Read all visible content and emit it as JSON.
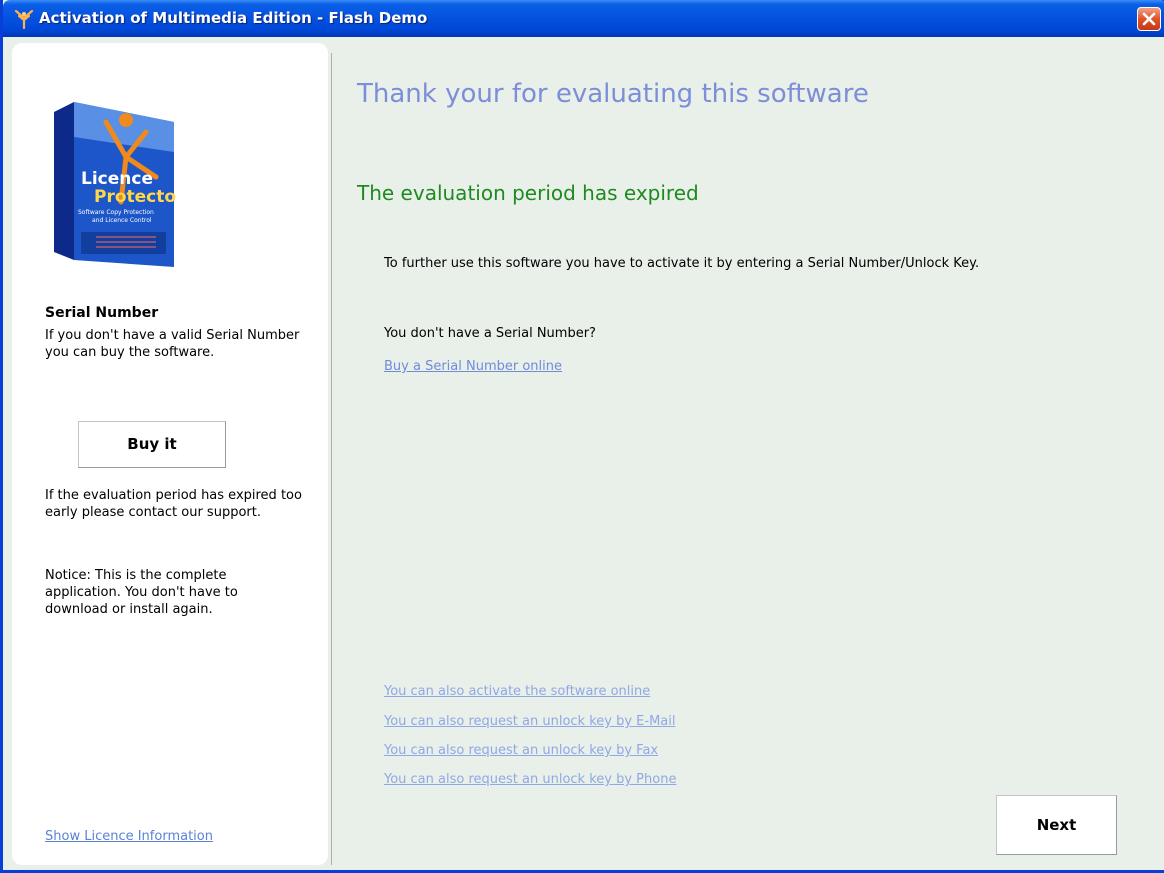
{
  "window": {
    "title": "Activation of Multimedia Edition - Flash Demo",
    "accent": "#0653e0"
  },
  "left": {
    "product_box_text": [
      "Licence",
      "Protector",
      "Software Copy Protection",
      "and Licence Control"
    ],
    "heading": "Serial Number",
    "intro": "If you don't have a valid Serial Number you can buy the software.",
    "buy_label": "Buy it",
    "support_text": "If the evaluation period has expired too early please contact our support.",
    "notice_text": "Notice: This is the complete application. You don't have to download or install again.",
    "licence_link": "Show Licence Information"
  },
  "main": {
    "title": "Thank your for evaluating this software",
    "expired": "The evaluation period has expired",
    "instruction": "To further use this software you have to activate it by entering a Serial Number/Unlock Key.",
    "no_serial_question": "You don't have a Serial Number?",
    "buy_online_link": "Buy a Serial Number online",
    "alt_links": [
      "You can also activate the software online",
      "You can also request an unlock key by E-Mail",
      "You can also request an unlock key by Fax",
      "You can also request an unlock key by Phone"
    ],
    "next_label": "Next"
  }
}
